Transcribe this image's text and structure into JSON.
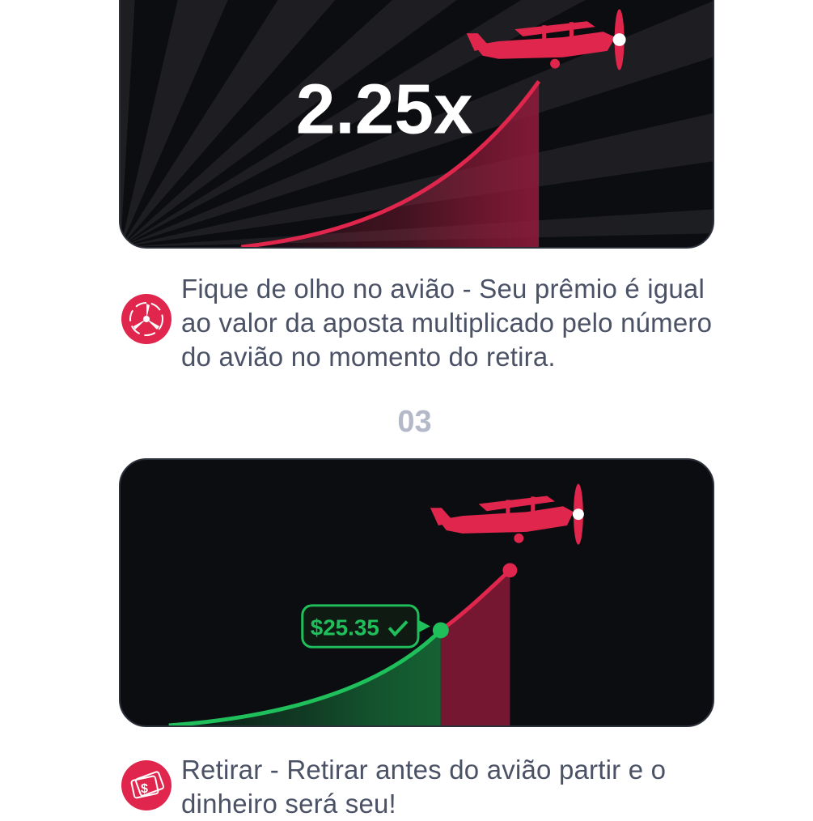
{
  "colors": {
    "accent": "#e0264c",
    "card_background": "#0c0d11",
    "cash_green": "#1fbf5b",
    "text": "#4b5266",
    "step_number": "#b3b9c8"
  },
  "top_card": {
    "multiplier": "2.25x",
    "icon": "red-biplane"
  },
  "step_watch": {
    "icon": "propeller-icon",
    "text": "Fique de olho no avião - Seu prêmio é igual ao valor da aposta multiplicado pelo número do avião no momento do retira."
  },
  "step_cashout": {
    "number": "03",
    "cashout_amount": "$25.35",
    "icon": "money-icon",
    "text": "Retirar - Retirar antes do avião partir e o dinheiro será seu!"
  }
}
